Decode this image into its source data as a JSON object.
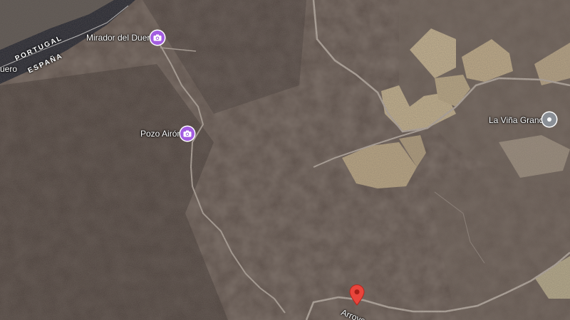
{
  "map": {
    "type": "satellite",
    "labels": {
      "portugal": "PORTUGAL",
      "espana": "ESPAÑA",
      "river_fragment": "uero",
      "road_fragment": "Arroyo"
    },
    "places": [
      {
        "name": "Mirador del Duero",
        "icon": "camera-icon",
        "pin_color": "#a35de0"
      },
      {
        "name": "Pozo Airón",
        "icon": "camera-icon",
        "pin_color": "#a35de0"
      },
      {
        "name": "La Viña Grande",
        "icon": "place-icon",
        "pin_color": "#8a8f96"
      }
    ],
    "dropped_pin": {
      "icon": "red-pin-icon",
      "color": "#e8453c"
    }
  }
}
